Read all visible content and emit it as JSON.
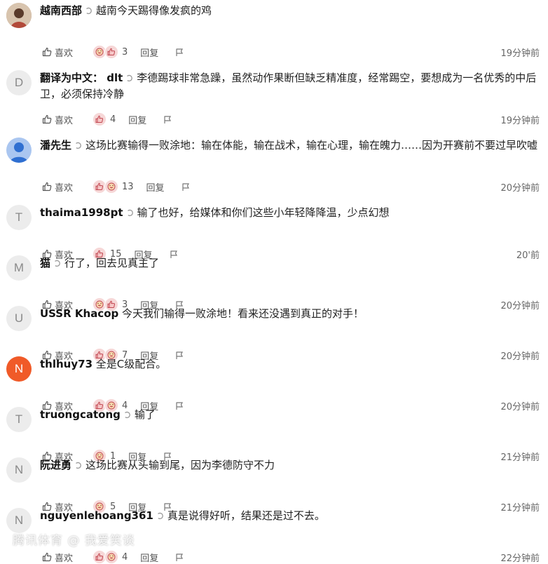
{
  "labels": {
    "like": "喜欢",
    "reply": "回复"
  },
  "comments": [
    {
      "avatar": "",
      "avatar_style": "photo",
      "user": "越南西部",
      "text": "越南今天踢得像发疯的鸡",
      "quote": true,
      "count": "3",
      "time": "19分钟前",
      "emojis": [
        "laugh",
        "thumb"
      ]
    },
    {
      "avatar": "D",
      "avatar_style": "gray",
      "user": "翻译为中文： dlt",
      "text": "李德踢球非常急躁，虽然动作果断但缺乏精准度，经常踢空，要想成为一名优秀的中后卫，必须保持冷静",
      "quote": true,
      "count": "4",
      "time": "19分钟前",
      "emojis": [
        "thumb"
      ]
    },
    {
      "avatar": "",
      "avatar_style": "blue",
      "user": "潘先生",
      "text": "这场比赛输得一败涂地：输在体能，输在战术，输在心理，输在魄力……因为开赛前不要过早吹嘘",
      "quote": true,
      "count": "13",
      "time": "20分钟前",
      "emojis": [
        "thumb",
        "laugh"
      ]
    },
    {
      "avatar": "T",
      "avatar_style": "gray",
      "user": "thaima1998pt",
      "text": "输了也好，给媒体和你们这些小年轻降降温，少点幻想",
      "quote": true,
      "count": "15",
      "time": "20'前",
      "emojis": [
        "thumb"
      ]
    },
    {
      "avatar": "M",
      "avatar_style": "gray",
      "user": "猫",
      "text": "行了，回去见真主了",
      "quote": true,
      "count": "3",
      "time": "20分钟前",
      "emojis": [
        "laugh",
        "thumb"
      ]
    },
    {
      "avatar": "U",
      "avatar_style": "gray",
      "user": "USSR Khacop",
      "text": "今天我们输得一败涂地！看来还没遇到真正的对手！",
      "quote": false,
      "count": "7",
      "time": "20分钟前",
      "emojis": [
        "thumb",
        "laugh"
      ]
    },
    {
      "avatar": "N",
      "avatar_style": "orange",
      "user": "thlhuy73",
      "text": "全是C级配合。",
      "quote": false,
      "count": "4",
      "time": "20分钟前",
      "emojis": [
        "thumb",
        "laugh"
      ]
    },
    {
      "avatar": "T",
      "avatar_style": "gray",
      "user": "truongcatong",
      "text": "输了",
      "quote": true,
      "count": "1",
      "time": "21分钟前",
      "emojis": [
        "laugh"
      ]
    },
    {
      "avatar": "N",
      "avatar_style": "gray",
      "user": "阮进勇",
      "text": "这场比赛从头输到尾，因为李德防守不力",
      "quote": true,
      "count": "5",
      "time": "21分钟前",
      "emojis": [
        "laugh"
      ]
    },
    {
      "avatar": "N",
      "avatar_style": "gray",
      "user": "nguyenlehoang361",
      "text": "真是说得好听，结果还是过不去。",
      "quote": true,
      "count": "4",
      "time": "22分钟前",
      "emojis": [
        "thumb",
        "laugh"
      ]
    }
  ],
  "watermark": "腾讯体育 @ 我爱笑谈"
}
